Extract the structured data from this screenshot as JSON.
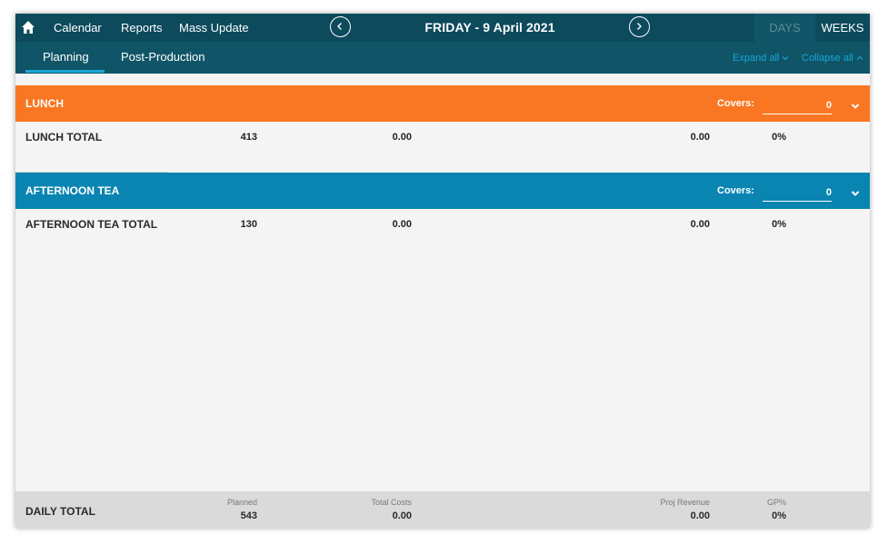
{
  "nav": {
    "calendar": "Calendar",
    "reports": "Reports",
    "mass_update": "Mass Update",
    "date": "FRIDAY - 9 April 2021",
    "days": "DAYS",
    "weeks": "WEEKS"
  },
  "tabs": {
    "planning": "Planning",
    "post_production": "Post-Production",
    "expand_all": "Expand all",
    "collapse_all": "Collapse all"
  },
  "sections": [
    {
      "title": "LUNCH",
      "covers_label": "Covers:",
      "covers_value": "0",
      "total_name": "LUNCH TOTAL",
      "planned": "413",
      "total_costs": "0.00",
      "proj_revenue": "0.00",
      "gp": "0%"
    },
    {
      "title": "AFTERNOON TEA",
      "covers_label": "Covers:",
      "covers_value": "0",
      "total_name": "AFTERNOON TEA TOTAL",
      "planned": "130",
      "total_costs": "0.00",
      "proj_revenue": "0.00",
      "gp": "0%"
    }
  ],
  "daily_total": {
    "name": "DAILY TOTAL",
    "planned_label": "Planned",
    "planned": "543",
    "costs_label": "Total Costs",
    "total_costs": "0.00",
    "revenue_label": "Proj Revenue",
    "proj_revenue": "0.00",
    "gp_label": "GP%",
    "gp": "0%"
  },
  "colors": {
    "top_bar": "#0c4a5c",
    "sub_bar": "#0f5567",
    "lunch_header": "#f97722",
    "tea_header": "#0a85b2",
    "accent_link": "#1aa6d8",
    "footer_bg": "#dadada"
  },
  "icons": {
    "home": "home-icon",
    "prev": "chevron-left-circle-icon",
    "next": "chevron-right-circle-icon",
    "expand": "chevron-down-icon",
    "collapse": "chevron-up-icon",
    "section_toggle": "chevron-down-icon"
  }
}
